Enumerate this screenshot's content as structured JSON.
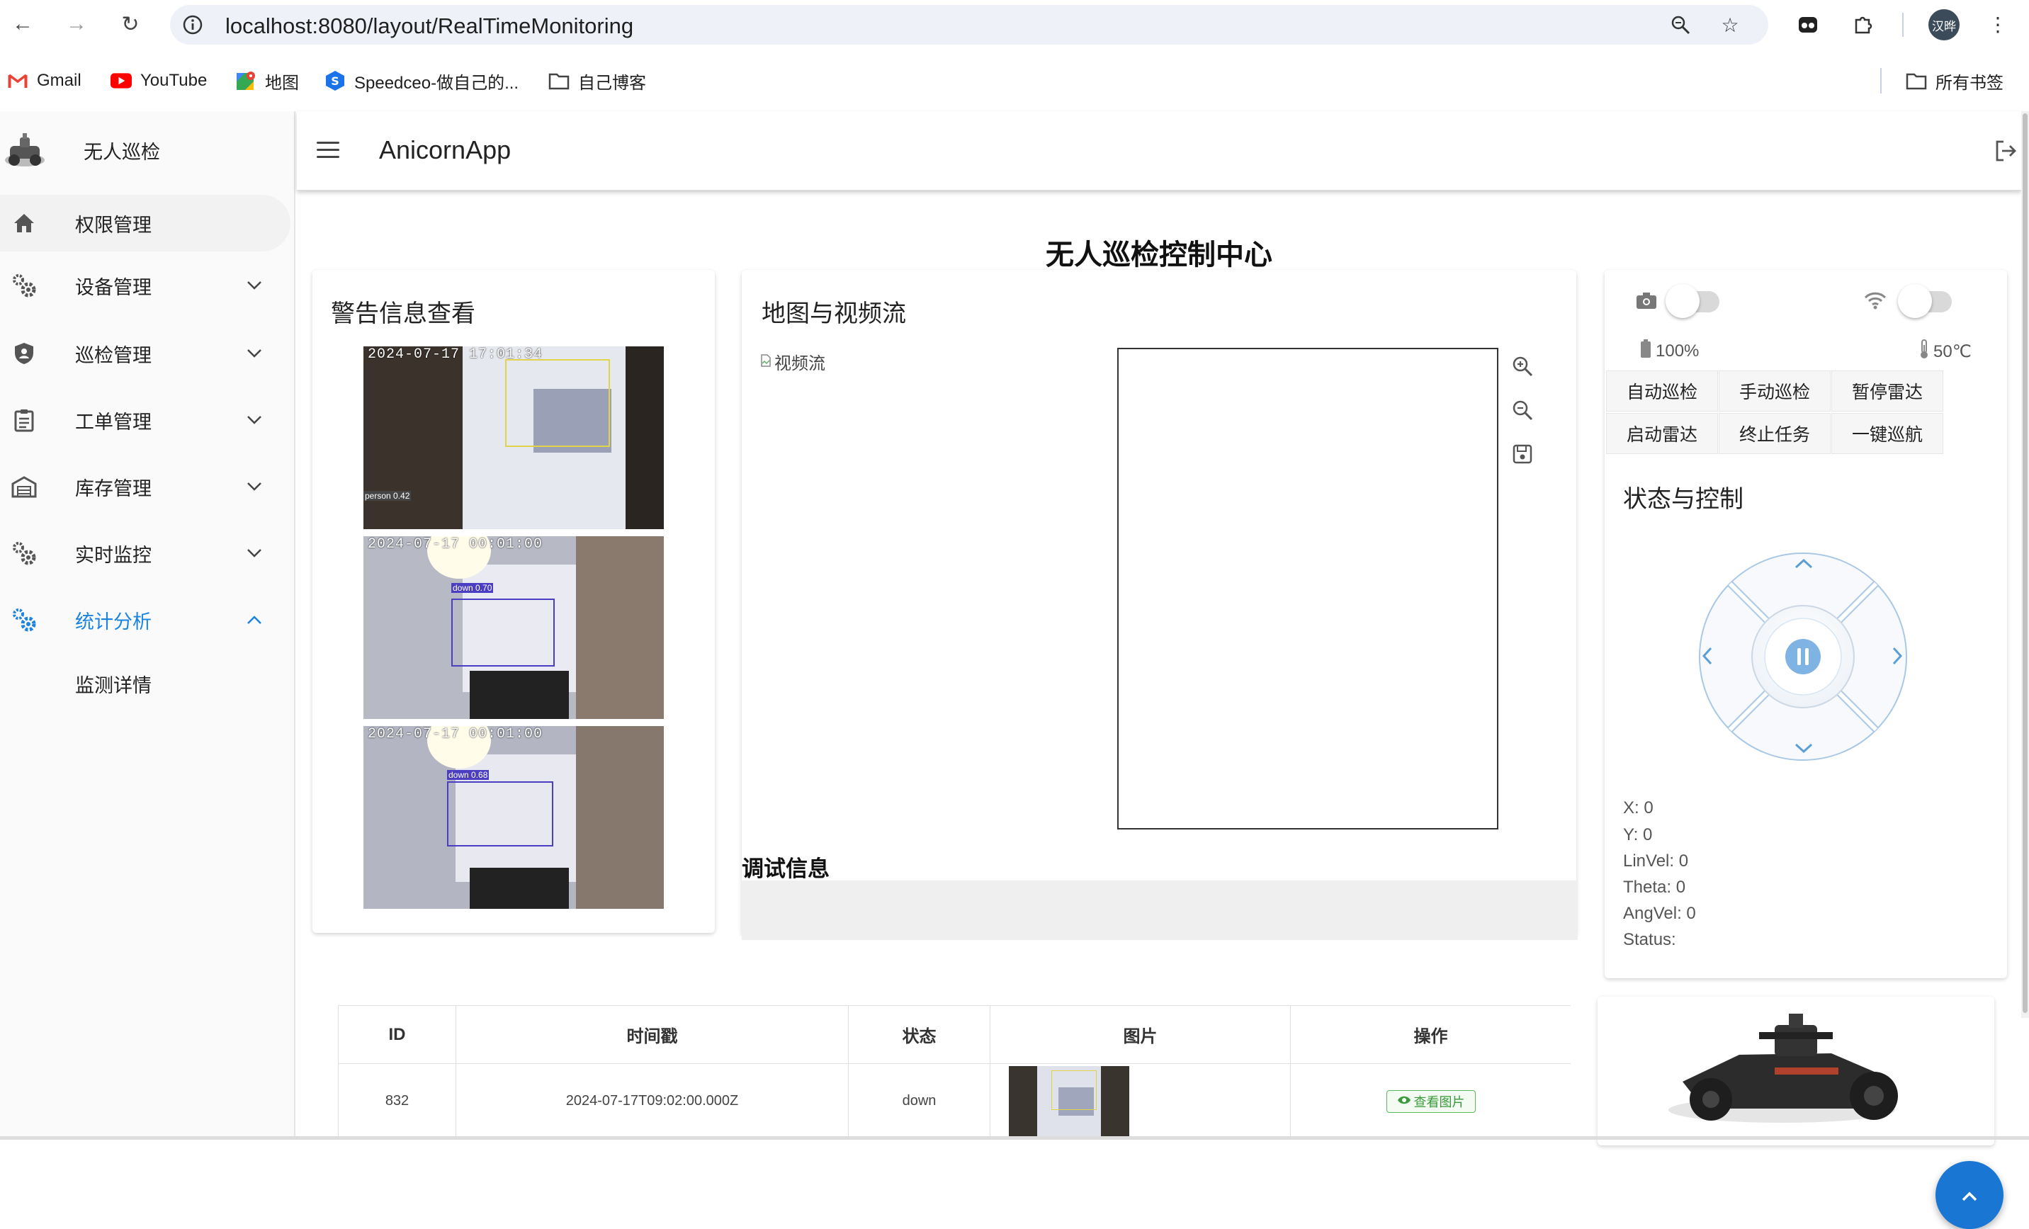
{
  "browser": {
    "url": "localhost:8080/layout/RealTimeMonitoring",
    "profile_label": "汉晔",
    "bookmarks": [
      {
        "label": "Gmail",
        "icon": "gmail-icon"
      },
      {
        "label": "YouTube",
        "icon": "youtube-icon"
      },
      {
        "label": "地图",
        "icon": "maps-icon"
      },
      {
        "label": "Speedceo-做自己的...",
        "icon": "speedceo-icon"
      },
      {
        "label": "自己博客",
        "icon": "folder-icon"
      }
    ],
    "all_bookmarks": "所有书签"
  },
  "sidebar": {
    "brand": "无人巡检",
    "items": [
      {
        "label": "权限管理",
        "icon": "home-icon"
      },
      {
        "label": "设备管理",
        "icon": "gears-icon"
      },
      {
        "label": "巡检管理",
        "icon": "shield-icon"
      },
      {
        "label": "工单管理",
        "icon": "clipboard-icon"
      },
      {
        "label": "库存管理",
        "icon": "warehouse-icon"
      },
      {
        "label": "实时监控",
        "icon": "gears-icon"
      },
      {
        "label": "统计分析",
        "icon": "gears-icon",
        "active": true,
        "expanded": true
      },
      {
        "label": "监测详情",
        "sub": true
      }
    ]
  },
  "topbar": {
    "title": "AnicornApp"
  },
  "main": {
    "page_title": "无人巡检控制中心",
    "alerts": {
      "title": "警告信息查看",
      "images": [
        {
          "timestamp": "2024-07-17  17:01:34",
          "label": "person 0.42"
        },
        {
          "timestamp": "2024-07-17  00:01:00",
          "label": "down 0.70"
        },
        {
          "timestamp": "2024-07-17  00:01:00",
          "label": "down 0.68"
        }
      ]
    },
    "map_video": {
      "title": "地图与视频流",
      "video_alt": "视频流",
      "debug_title": "调试信息",
      "debug_text": ""
    },
    "control": {
      "battery": "100%",
      "temperature": "50℃",
      "buttons": [
        "自动巡检",
        "手动巡检",
        "暂停雷达",
        "启动雷达",
        "终止任务",
        "一键巡航"
      ],
      "title": "状态与控制",
      "telemetry": [
        "X: 0",
        "Y: 0",
        "LinVel: 0",
        "Theta: 0",
        "AngVel: 0",
        "Status:"
      ]
    },
    "table": {
      "headers": [
        "ID",
        "时间戳",
        "状态",
        "图片",
        "操作"
      ],
      "rows": [
        {
          "id": "832",
          "timestamp": "2024-07-17T09:02:00.000Z",
          "status": "down",
          "action": "查看图片"
        }
      ]
    }
  },
  "colors": {
    "accent": "#1a84e0",
    "fab": "#1976d2",
    "view_button": "#5cb85c"
  }
}
